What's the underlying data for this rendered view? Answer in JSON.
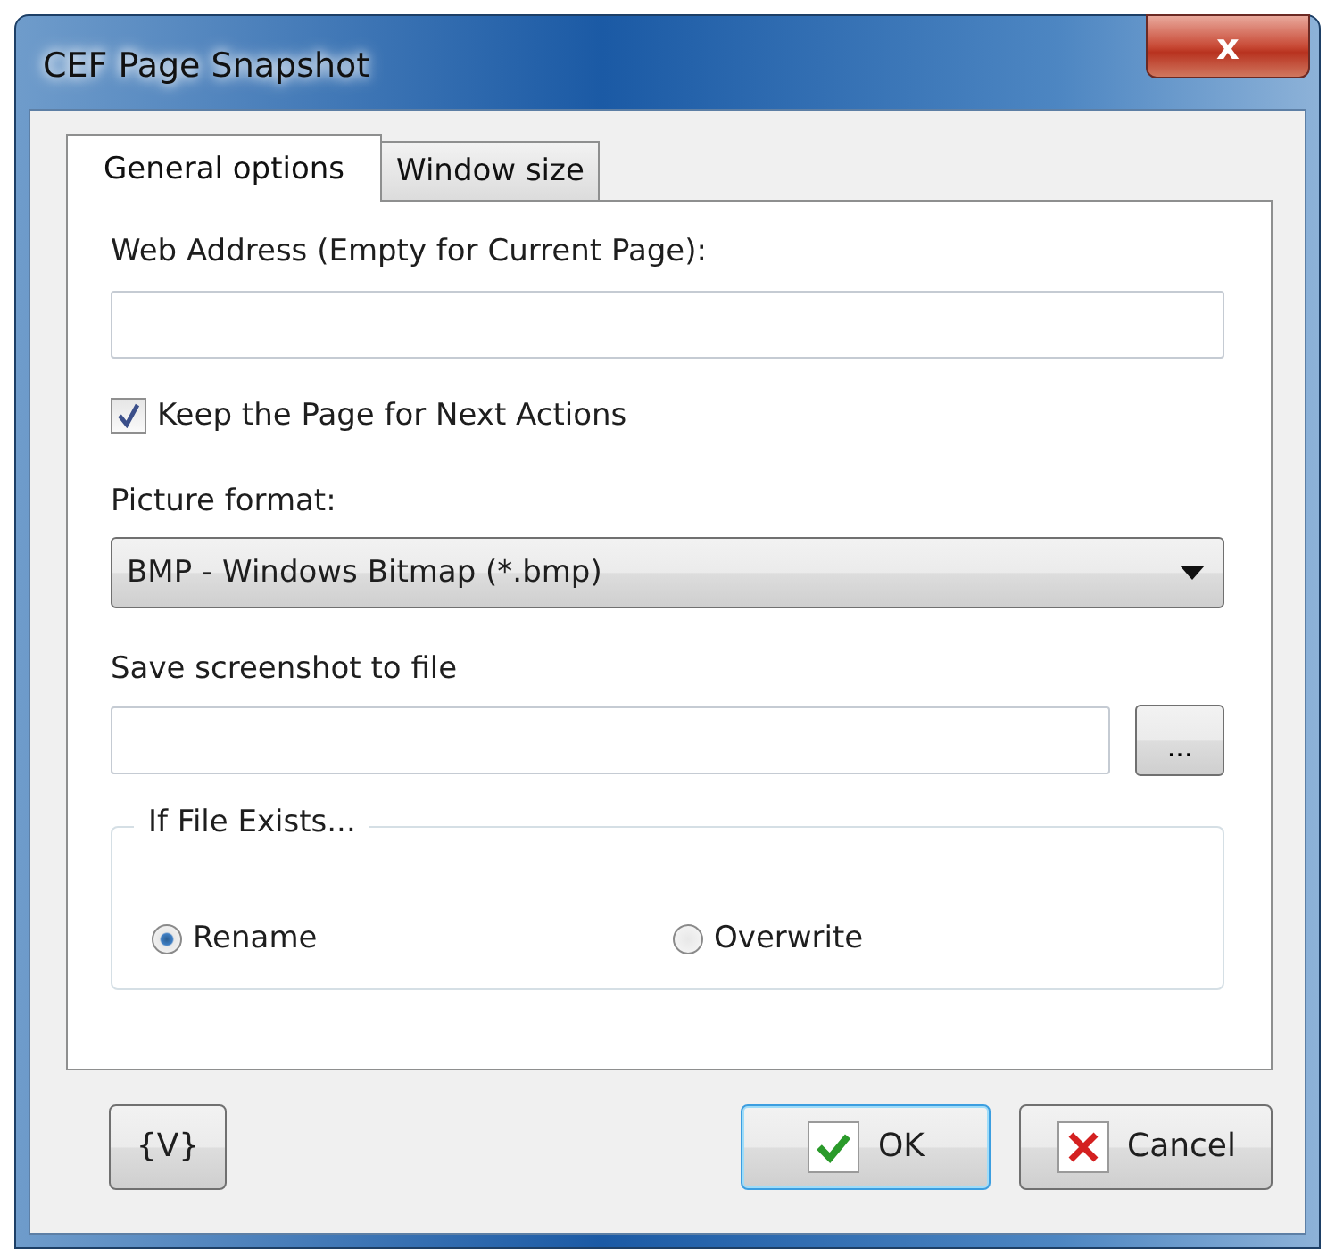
{
  "window": {
    "title": "CEF Page Snapshot",
    "close_label": "x"
  },
  "tabs": [
    {
      "label": "General options",
      "selected": true
    },
    {
      "label": "Window size",
      "selected": false
    }
  ],
  "web_address": {
    "label": "Web Address (Empty for Current Page):"
  },
  "keep_page": {
    "label": "Keep the Page for Next Actions",
    "checked": true
  },
  "picture_format": {
    "label": "Picture format:",
    "value": "BMP - Windows Bitmap (*.bmp)"
  },
  "save_file": {
    "label": "Save screenshot to file",
    "browse_label": "..."
  },
  "if_file_exists": {
    "title": "If File Exists...",
    "options": [
      {
        "label": "Rename",
        "selected": true
      },
      {
        "label": "Overwrite",
        "selected": false
      }
    ]
  },
  "buttons": [
    {
      "kind": "variables",
      "label": "{V}",
      "focused": false
    },
    {
      "kind": "ok",
      "label": "OK",
      "focused": true
    },
    {
      "kind": "cancel",
      "label": "Cancel",
      "focused": false
    }
  ]
}
